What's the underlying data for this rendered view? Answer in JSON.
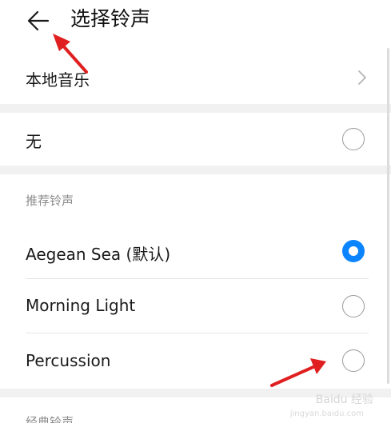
{
  "header": {
    "title": "选择铃声",
    "back_icon": "arrow-left-icon"
  },
  "local_music": {
    "label": "本地音乐",
    "chevron_icon": "chevron-right-icon"
  },
  "none_option": {
    "label": "无",
    "selected": false
  },
  "recommended": {
    "header": "推荐铃声",
    "items": [
      {
        "label": "Aegean Sea (默认)",
        "selected": true
      },
      {
        "label": "Morning Light",
        "selected": false
      },
      {
        "label": "Percussion",
        "selected": false
      }
    ]
  },
  "classic": {
    "header": "经典铃声"
  },
  "watermark": {
    "text": "Baidu 经验",
    "sub": "jingyan.baidu.com"
  },
  "colors": {
    "accent": "#0a84ff",
    "annotation": "#e02020",
    "gap": "#f1f1f1"
  }
}
